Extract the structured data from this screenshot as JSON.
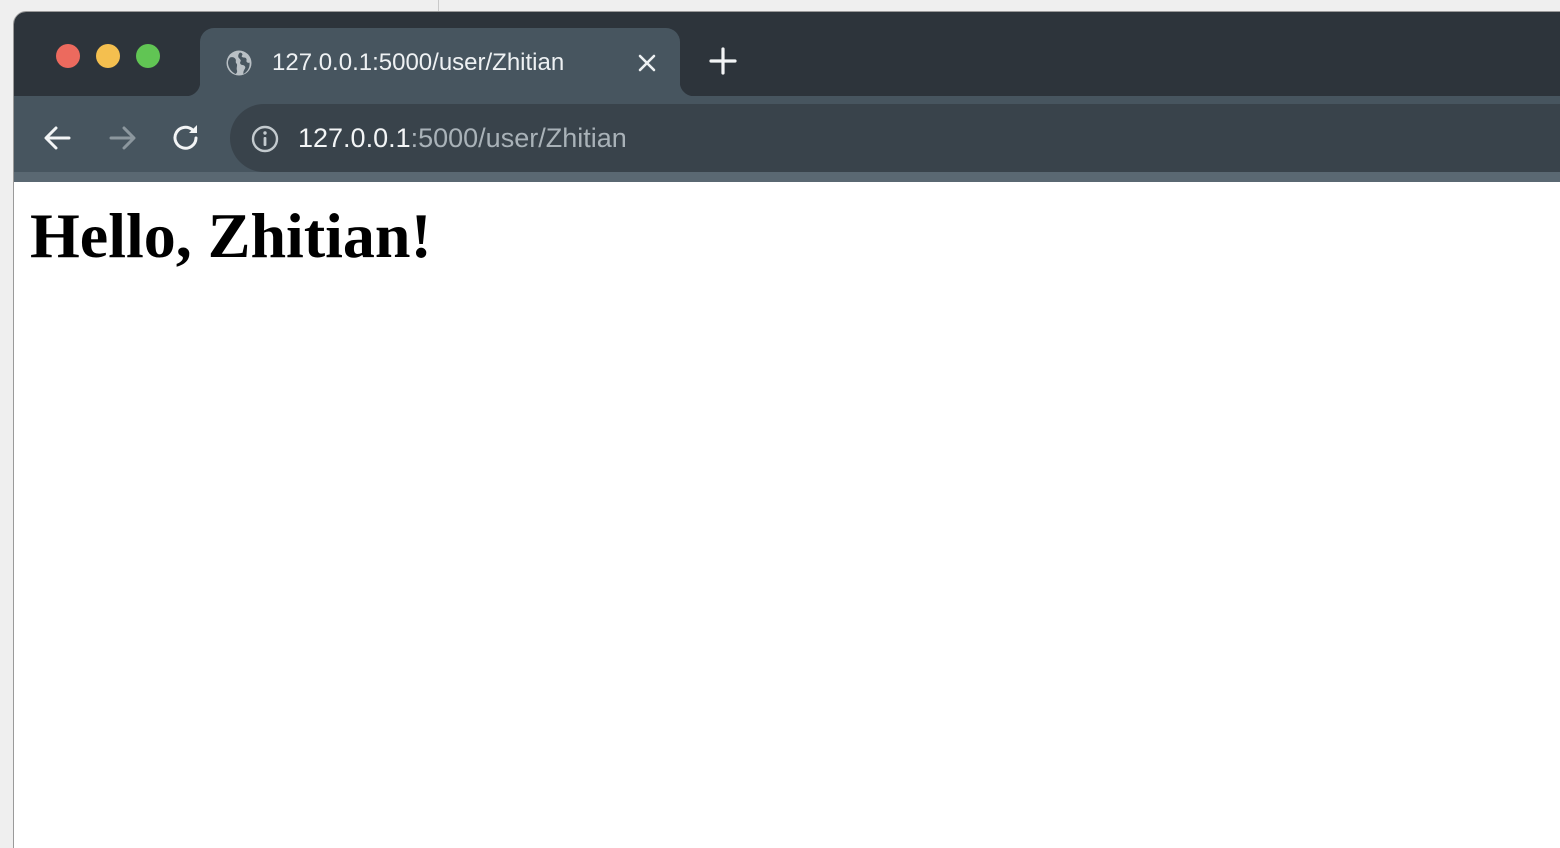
{
  "browser": {
    "tab": {
      "title": "127.0.0.1:5000/user/Zhitian",
      "favicon": "globe-icon"
    },
    "address_bar": {
      "host": "127.0.0.1",
      "path": ":5000/user/Zhitian"
    },
    "icons": {
      "back": "arrow-left-icon",
      "forward": "arrow-right-icon",
      "reload": "reload-icon",
      "site_info": "info-icon",
      "tab_close": "close-icon",
      "new_tab": "plus-icon"
    },
    "colors": {
      "close_light": "#ec6a5e",
      "minimize_light": "#f4bf4f",
      "maximize_light": "#61c554",
      "tab_strip": "#2d343b",
      "active_tab": "#47555f",
      "omnibox": "#39434b"
    }
  },
  "page": {
    "heading": "Hello, Zhitian!"
  }
}
